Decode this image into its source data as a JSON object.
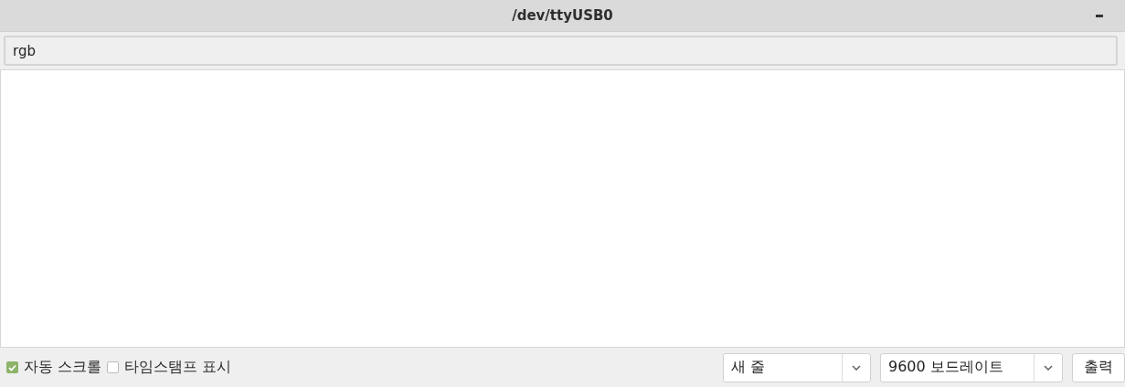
{
  "window": {
    "title": "/dev/ttyUSB0"
  },
  "input": {
    "value": "rgb"
  },
  "footer": {
    "checkboxes": [
      {
        "label": "자동 스크롤",
        "checked": true
      },
      {
        "label": "타임스탬프 표시",
        "checked": false
      }
    ],
    "dropdowns": [
      {
        "value": "새 줄"
      },
      {
        "value": "9600 보드레이트"
      }
    ],
    "button": {
      "label": "출력"
    }
  }
}
